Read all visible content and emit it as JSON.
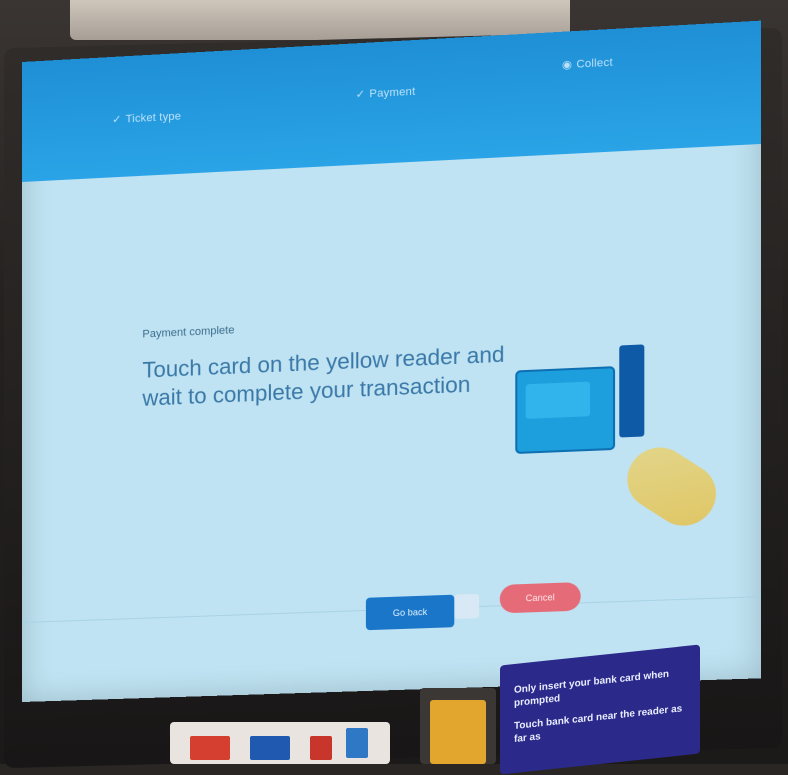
{
  "header": {
    "steps": [
      {
        "label": "Ticket type",
        "state": "done"
      },
      {
        "label": "Payment",
        "state": "done"
      },
      {
        "label": "Collect",
        "state": "active"
      }
    ]
  },
  "main": {
    "status_label": "Payment complete",
    "instruction": "Touch card on the yellow reader and wait to complete your transaction"
  },
  "footer": {
    "back_label": "Go back",
    "cancel_label": "Cancel"
  },
  "kiosk_panel": {
    "lines": [
      "Only insert your bank card when prompted",
      "Touch bank card near the reader as far as"
    ]
  },
  "colors": {
    "screen_bg": "#bfe3f2",
    "header_blue": "#1f8fd6",
    "instruction_text": "#3a78a8",
    "cancel_button": "#e66b78",
    "reader_yellow": "#e2a52e"
  }
}
